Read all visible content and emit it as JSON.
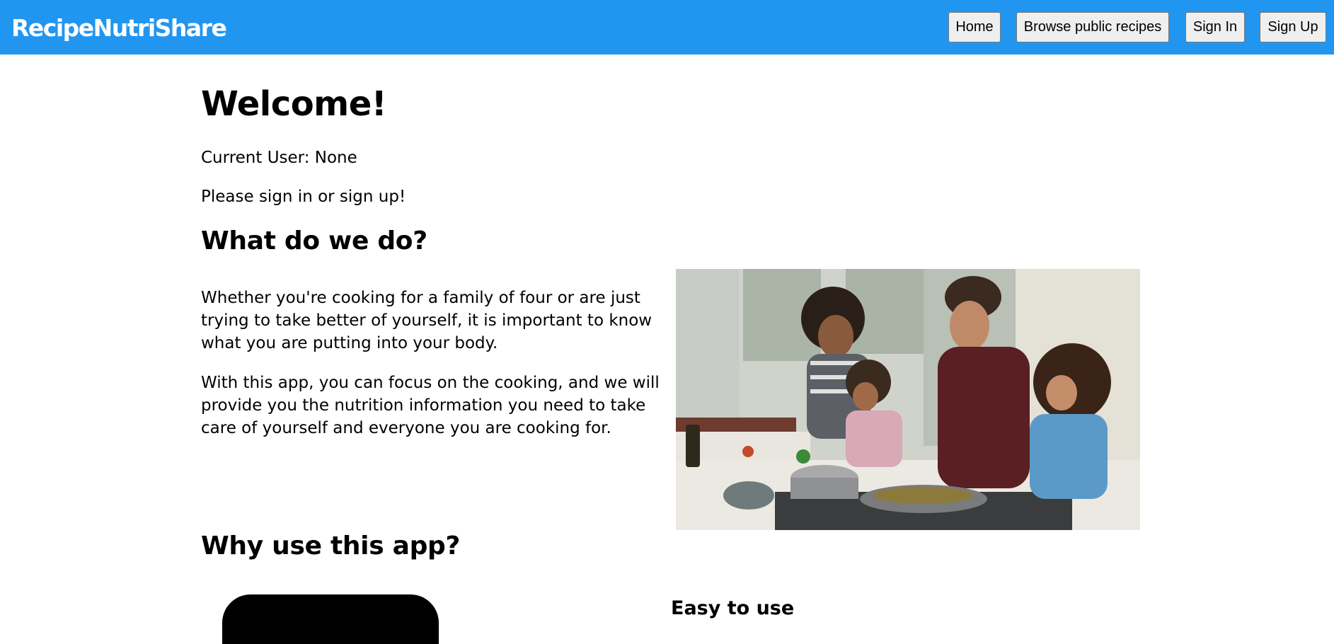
{
  "nav": {
    "brand": "RecipeNutriShare",
    "buttons": {
      "home": "Home",
      "browse": "Browse public recipes",
      "signin": "Sign In",
      "signup": "Sign Up"
    },
    "bar_color": "#2196f0"
  },
  "main": {
    "title": "Welcome!",
    "current_user": "Current User: None",
    "signin_prompt": "Please sign in or sign up!",
    "what_heading": "What do we do?",
    "paragraphs": [
      "Whether you're cooking for a family of four or are just trying to take better of yourself, it is important to know what you are putting into your body.",
      "With this app, you can focus on the cooking, and we will provide you the nutrition information you need to take care of yourself and everyone you are cooking for."
    ],
    "why_heading": "Why use this app?",
    "feature_heading": "Easy to use"
  }
}
